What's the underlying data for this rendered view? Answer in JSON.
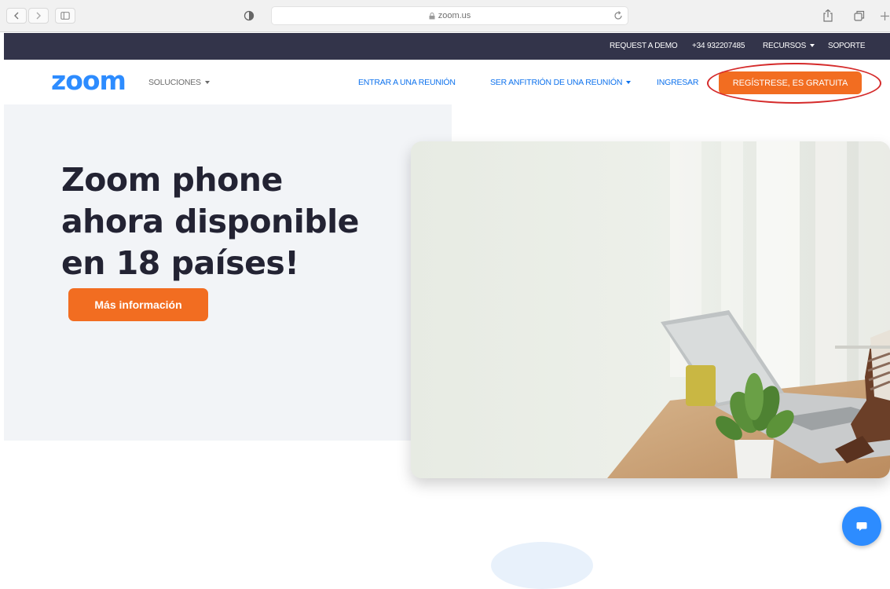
{
  "browser": {
    "url": "zoom.us"
  },
  "topbar": {
    "request_demo": "REQUEST A DEMO",
    "phone": "+34 932207485",
    "resources": "RECURSOS",
    "support": "SOPORTE"
  },
  "nav": {
    "logo": "zoom",
    "solutions": "SOLUCIONES",
    "join_meeting": "ENTRAR A UNA REUNIÓN",
    "host_meeting": "SER ANFITRIÓN DE UNA REUNIÓN",
    "sign_in": "INGRESAR",
    "signup": "REGÍSTRESE, ES GRATUITA"
  },
  "hero": {
    "title": "Zoom phone ahora disponible en 18 países!",
    "cta": "Más información"
  },
  "colors": {
    "brand_blue": "#2d8cff",
    "accent_orange": "#f26d21",
    "topbar_bg": "#33344a",
    "annotation_red": "#d52b2b"
  },
  "icons": [
    "back-icon",
    "forward-icon",
    "sidebar-icon",
    "privacy-shield-icon",
    "lock-icon",
    "reload-icon",
    "share-icon",
    "tabs-icon",
    "new-tab-icon",
    "chat-icon"
  ]
}
